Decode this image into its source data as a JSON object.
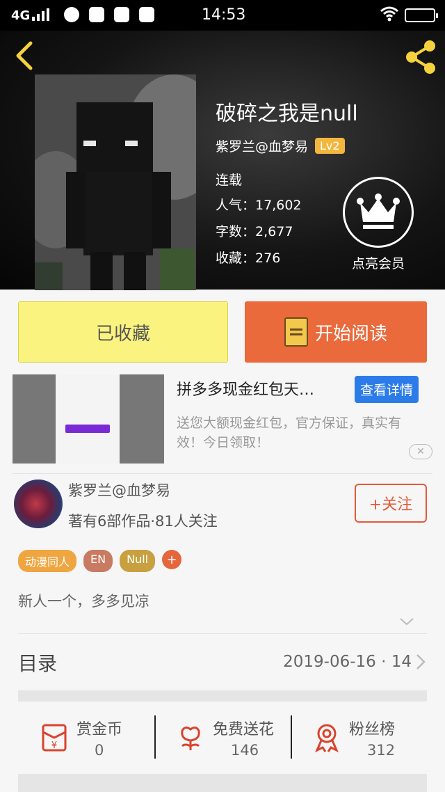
{
  "status_bar": {
    "network": "4G",
    "time": "14:53"
  },
  "book": {
    "title": "破碎之我是null",
    "author": "紫罗兰@血梦易",
    "level": "Lv2",
    "status": "连载",
    "popularity_label": "人气：",
    "popularity": "17,602",
    "words_label": "字数：",
    "words": "2,677",
    "favorites_label": "收藏：",
    "favorites": "276",
    "vip_label": "点亮会员"
  },
  "actions": {
    "favorite": "已收藏",
    "read": "开始阅读"
  },
  "ad": {
    "title": "拼多多现金红包天…",
    "detail_button": "查看详情",
    "description": "送您大额现金红包，官方保证，真实有效！今日领取！"
  },
  "author_card": {
    "name": "紫罗兰@血梦易",
    "meta": "著有6部作品·81人关注",
    "follow": "+关注"
  },
  "tags": [
    {
      "label": "动漫同人",
      "color": "#f0a640"
    },
    {
      "label": "EN",
      "color": "#c97a62"
    },
    {
      "label": "Null",
      "color": "#c9a040"
    }
  ],
  "tag_add": "+",
  "intro": "新人一个，多多见凉",
  "toc": {
    "label": "目录",
    "update": "2019-06-16 · 14"
  },
  "stats": [
    {
      "name": "赏金币",
      "value": "0",
      "icon": "reward-coin-icon"
    },
    {
      "name": "免费送花",
      "value": "146",
      "icon": "flower-icon"
    },
    {
      "name": "粉丝榜",
      "value": "312",
      "icon": "medal-icon"
    }
  ],
  "colors": {
    "accent": "#ea6a3c",
    "favorite_bg": "#fbf380",
    "link_blue": "#2b7ce9",
    "level_badge": "#f3b73e"
  }
}
